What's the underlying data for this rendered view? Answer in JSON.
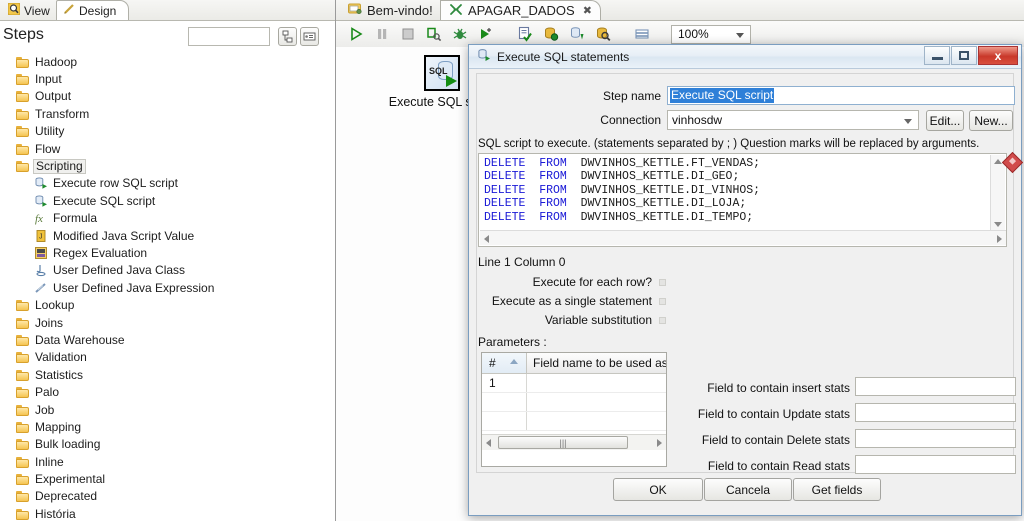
{
  "left_panel": {
    "tabs": [
      {
        "label": "View",
        "icon": "magnifier-icon",
        "active": false
      },
      {
        "label": "Design",
        "icon": "pencil-icon",
        "active": true
      }
    ],
    "title": "Steps",
    "search_value": "",
    "search_placeholder": "",
    "header_buttons": [
      {
        "name": "collapse-all-button",
        "icon": "tree-collapse-icon"
      },
      {
        "name": "show-details-button",
        "icon": "list-details-icon"
      }
    ],
    "tree": [
      {
        "label": "Hadoop",
        "type": "folder",
        "indent": 0,
        "selected": false
      },
      {
        "label": "Input",
        "type": "folder",
        "indent": 0,
        "selected": false
      },
      {
        "label": "Output",
        "type": "folder",
        "indent": 0,
        "selected": false
      },
      {
        "label": "Transform",
        "type": "folder",
        "indent": 0,
        "selected": false
      },
      {
        "label": "Utility",
        "type": "folder",
        "indent": 0,
        "selected": false
      },
      {
        "label": "Flow",
        "type": "folder",
        "indent": 0,
        "selected": false
      },
      {
        "label": "Scripting",
        "type": "folder",
        "indent": 0,
        "selected": true
      },
      {
        "label": "Execute row SQL script",
        "type": "sql-script-icon",
        "indent": 1,
        "selected": false
      },
      {
        "label": "Execute SQL script",
        "type": "sql-script-icon",
        "indent": 1,
        "selected": false
      },
      {
        "label": "Formula",
        "type": "formula-icon",
        "indent": 1,
        "selected": false
      },
      {
        "label": "Modified Java Script Value",
        "type": "javascript-icon",
        "indent": 1,
        "selected": false
      },
      {
        "label": "Regex Evaluation",
        "type": "regex-icon",
        "indent": 1,
        "selected": false
      },
      {
        "label": "User Defined Java Class",
        "type": "java-class-icon",
        "indent": 1,
        "selected": false
      },
      {
        "label": "User Defined Java Expression",
        "type": "java-expression-icon",
        "indent": 1,
        "selected": false
      },
      {
        "label": "Lookup",
        "type": "folder",
        "indent": 0,
        "selected": false
      },
      {
        "label": "Joins",
        "type": "folder",
        "indent": 0,
        "selected": false
      },
      {
        "label": "Data Warehouse",
        "type": "folder",
        "indent": 0,
        "selected": false
      },
      {
        "label": "Validation",
        "type": "folder",
        "indent": 0,
        "selected": false
      },
      {
        "label": "Statistics",
        "type": "folder",
        "indent": 0,
        "selected": false
      },
      {
        "label": "Palo",
        "type": "folder",
        "indent": 0,
        "selected": false
      },
      {
        "label": "Job",
        "type": "folder",
        "indent": 0,
        "selected": false
      },
      {
        "label": "Mapping",
        "type": "folder",
        "indent": 0,
        "selected": false
      },
      {
        "label": "Bulk loading",
        "type": "folder",
        "indent": 0,
        "selected": false
      },
      {
        "label": "Inline",
        "type": "folder",
        "indent": 0,
        "selected": false
      },
      {
        "label": "Experimental",
        "type": "folder",
        "indent": 0,
        "selected": false
      },
      {
        "label": "Deprecated",
        "type": "folder",
        "indent": 0,
        "selected": false
      },
      {
        "label": "História",
        "type": "folder",
        "indent": 0,
        "selected": false
      }
    ]
  },
  "main": {
    "tabs": [
      {
        "label": "Bem-vindo!",
        "icon": "welcome-icon",
        "active": false,
        "closable": false
      },
      {
        "label": "APAGAR_DADOS",
        "icon": "transformation-icon",
        "active": true,
        "closable": true
      }
    ],
    "toolbar": [
      {
        "name": "run-button",
        "icon": "play-icon"
      },
      {
        "name": "pause-button",
        "icon": "pause-icon"
      },
      {
        "name": "stop-button",
        "icon": "stop-icon"
      },
      {
        "name": "preview-button",
        "icon": "preview-icon"
      },
      {
        "name": "debug-button",
        "icon": "bug-icon"
      },
      {
        "name": "replay-button",
        "icon": "play-plus-icon"
      },
      {
        "name": "verify-button",
        "icon": "checklist-icon"
      },
      {
        "name": "impact-analysis-button",
        "icon": "database-impact-icon"
      },
      {
        "name": "get-sql-button",
        "icon": "sql-download-icon"
      },
      {
        "name": "explore-db-button",
        "icon": "database-search-icon"
      },
      {
        "name": "show-grid-button",
        "icon": "grid-icon"
      }
    ],
    "zoom_level": "100%",
    "canvas_step": {
      "label": "Execute SQL script",
      "icon": "sql-script-step-icon",
      "icon_text": "SQL"
    }
  },
  "dialog": {
    "title": "Execute SQL statements",
    "title_icon": "sql-script-icon",
    "window_buttons": {
      "minimize": "minimize-icon",
      "maximize": "maximize-icon",
      "close": "x"
    },
    "step_name_label": "Step name",
    "step_name_value": "Execute SQL script",
    "step_name_selected": true,
    "connection_label": "Connection",
    "connection_value": "vinhosdw",
    "edit_button": "Edit...",
    "new_button": "New...",
    "sql_help": "SQL script to execute. (statements separated by ; ) Question marks will be replaced by arguments.",
    "sql_lines": [
      {
        "keyword": "DELETE  FROM",
        "rest": "  DWVINHOS_KETTLE.FT_VENDAS;"
      },
      {
        "keyword": "DELETE  FROM",
        "rest": "  DWVINHOS_KETTLE.DI_GEO;"
      },
      {
        "keyword": "DELETE  FROM",
        "rest": "  DWVINHOS_KETTLE.DI_VINHOS;"
      },
      {
        "keyword": "DELETE  FROM",
        "rest": "  DWVINHOS_KETTLE.DI_LOJA;"
      },
      {
        "keyword": "DELETE  FROM",
        "rest": "  DWVINHOS_KETTLE.DI_TEMPO;"
      }
    ],
    "sql_text": "DELETE  FROM  DWVINHOS_KETTLE.FT_VENDAS;\nDELETE  FROM  DWVINHOS_KETTLE.DI_GEO;\nDELETE  FROM  DWVINHOS_KETTLE.DI_VINHOS;\nDELETE  FROM  DWVINHOS_KETTLE.DI_LOJA;\nDELETE  FROM  DWVINHOS_KETTLE.DI_TEMPO;",
    "cursor_status": "Line 1 Column 0",
    "checkboxes": [
      {
        "label": "Execute for each row?",
        "checked": false
      },
      {
        "label": "Execute as a single statement",
        "checked": false
      },
      {
        "label": "Variable substitution",
        "checked": false
      }
    ],
    "parameters_label": "Parameters :",
    "param_table": {
      "columns": [
        "#",
        "Field name to be used as a"
      ],
      "rows": [
        {
          "index": "1",
          "field_name": ""
        }
      ]
    },
    "stat_fields": [
      {
        "label": "Field to contain insert stats",
        "value": ""
      },
      {
        "label": "Field to contain Update stats",
        "value": ""
      },
      {
        "label": "Field to contain Delete stats",
        "value": ""
      },
      {
        "label": "Field to contain Read stats",
        "value": ""
      }
    ],
    "buttons": {
      "ok": "OK",
      "cancel": "Cancela",
      "get_fields": "Get fields"
    }
  },
  "colors": {
    "accent_blue": "#2f80d8",
    "sql_keyword": "#1a19d6",
    "folder_yellow": "#f5c451",
    "close_red": "#c9382a",
    "play_green": "#128c12"
  }
}
